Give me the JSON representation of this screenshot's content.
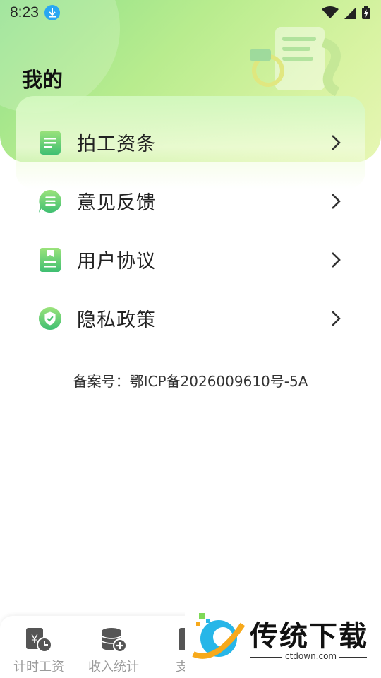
{
  "status_bar": {
    "time": "8:23",
    "icons": [
      "download-badge-icon",
      "wifi-icon",
      "signal-icon",
      "battery-charging-icon"
    ]
  },
  "page": {
    "title": "我的"
  },
  "menu": {
    "items": [
      {
        "label": "拍工资条",
        "icon": "payslip-document-icon"
      },
      {
        "label": "意见反馈",
        "icon": "feedback-list-icon"
      },
      {
        "label": "用户协议",
        "icon": "user-agreement-bookmark-icon"
      },
      {
        "label": "隐私政策",
        "icon": "privacy-shield-icon"
      }
    ]
  },
  "icp": {
    "text": "备案号：鄂ICP备2026009610号-5A"
  },
  "bottom_nav": {
    "items": [
      {
        "label": "计时工资",
        "icon": "timesheet-wage-icon"
      },
      {
        "label": "收入统计",
        "icon": "income-stats-icon"
      },
      {
        "label": "支出",
        "icon": "expense-icon"
      }
    ]
  },
  "watermark": {
    "title": "传统下载",
    "domain": "ctdown.com"
  },
  "colors": {
    "accent_green": "#5cc96a",
    "header_gradient_start": "#8fe08a",
    "header_gradient_end": "#e7f6b4",
    "nav_label": "#9a9a9a"
  }
}
